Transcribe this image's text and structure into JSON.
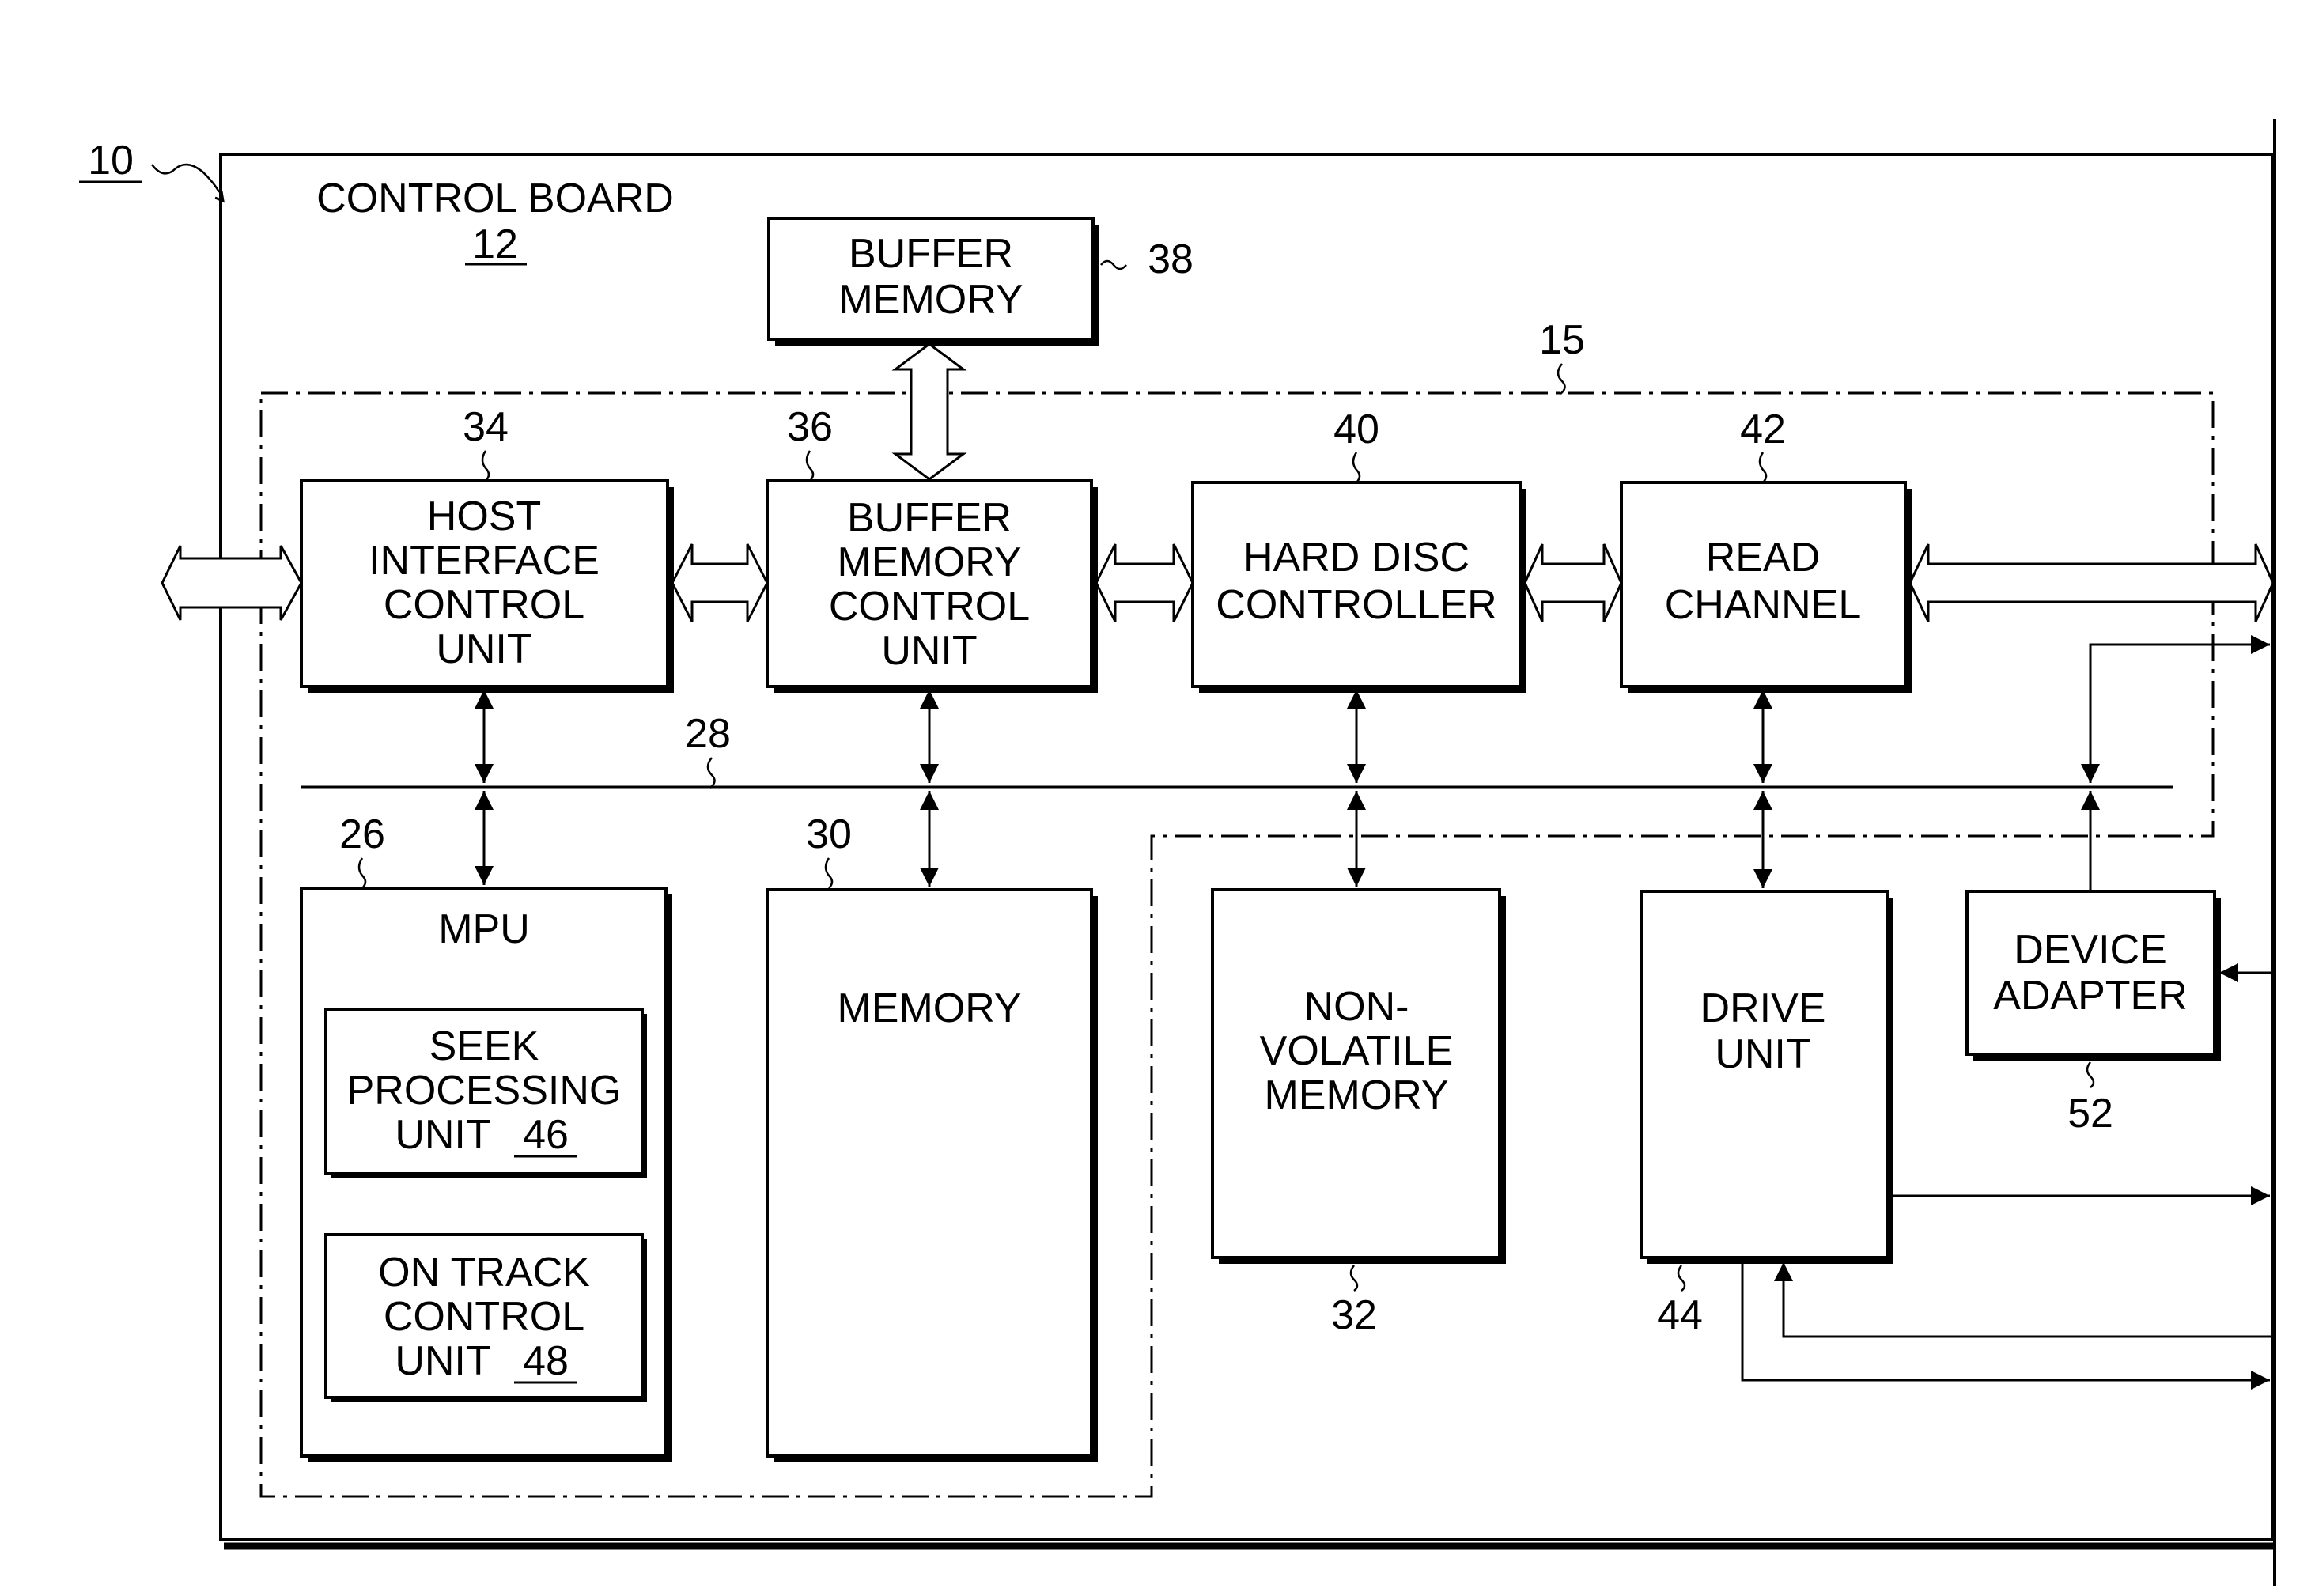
{
  "figure": {
    "system_ref": "10",
    "board": {
      "title": "CONTROL BOARD",
      "ref": "12"
    },
    "region_ref": "15",
    "bus_ref": "28"
  },
  "blocks": {
    "host_interface": {
      "lines": [
        "HOST",
        "INTERFACE",
        "CONTROL",
        "UNIT"
      ],
      "ref": "34"
    },
    "buffer_memory_control": {
      "lines": [
        "BUFFER",
        "MEMORY",
        "CONTROL",
        "UNIT"
      ],
      "ref": "36"
    },
    "buffer_memory": {
      "lines": [
        "BUFFER",
        "MEMORY"
      ],
      "ref": "38"
    },
    "hard_disc_controller": {
      "lines": [
        "HARD DISC",
        "CONTROLLER"
      ],
      "ref": "40"
    },
    "read_channel": {
      "lines": [
        "READ",
        "CHANNEL"
      ],
      "ref": "42"
    },
    "mpu": {
      "lines": [
        "MPU"
      ],
      "ref": "26"
    },
    "seek_processing": {
      "lines": [
        "SEEK",
        "PROCESSING",
        "UNIT"
      ],
      "ref": "46"
    },
    "on_track_control": {
      "lines": [
        "ON TRACK",
        "CONTROL",
        "UNIT"
      ],
      "ref": "48"
    },
    "memory": {
      "lines": [
        "MEMORY"
      ],
      "ref": "30"
    },
    "non_volatile_memory": {
      "lines": [
        "NON-",
        "VOLATILE",
        "MEMORY"
      ],
      "ref": "32"
    },
    "drive_unit": {
      "lines": [
        "DRIVE",
        "UNIT"
      ],
      "ref": "44"
    },
    "device_adapter": {
      "lines": [
        "DEVICE",
        "ADAPTER"
      ],
      "ref": "52"
    }
  }
}
